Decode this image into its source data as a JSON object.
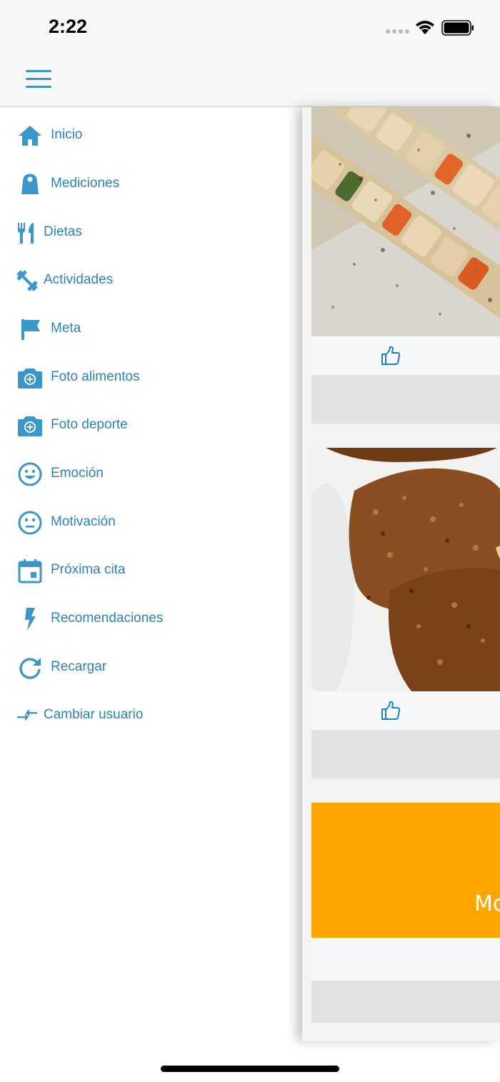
{
  "status_bar": {
    "time": "2:22"
  },
  "nav": {
    "menu_icon": "hamburger-icon"
  },
  "menu": {
    "items": [
      {
        "label": "Inicio",
        "icon": "home-icon"
      },
      {
        "label": "Mediciones",
        "icon": "scale-icon"
      },
      {
        "label": "Dietas",
        "icon": "fork-knife-icon"
      },
      {
        "label": "Actividades",
        "icon": "dumbbell-icon"
      },
      {
        "label": "Meta",
        "icon": "flag-icon"
      },
      {
        "label": "Foto alimentos",
        "icon": "camera-plus-icon"
      },
      {
        "label": "Foto deporte",
        "icon": "camera-plus-icon"
      },
      {
        "label": "Emoción",
        "icon": "smile-icon"
      },
      {
        "label": "Motivación",
        "icon": "neutral-face-icon"
      },
      {
        "label": "Próxima cita",
        "icon": "calendar-icon"
      },
      {
        "label": "Recomendaciones",
        "icon": "lightning-icon"
      },
      {
        "label": "Recargar",
        "icon": "reload-icon"
      },
      {
        "label": "Cambiar usuario",
        "icon": "swap-arrows-icon"
      }
    ]
  },
  "feed": {
    "cards": [
      {
        "image": "chicken-skewers-photo",
        "like_icon": "thumbs-up-icon"
      },
      {
        "image": "breaded-chicken-photo",
        "like_icon": "thumbs-up-icon"
      },
      {
        "banner_text": "Mo",
        "banner_color": "#ffa500"
      }
    ]
  },
  "colors": {
    "accent": "#2a84b8",
    "icon": "#3a97cc",
    "banner": "#ffa500"
  }
}
